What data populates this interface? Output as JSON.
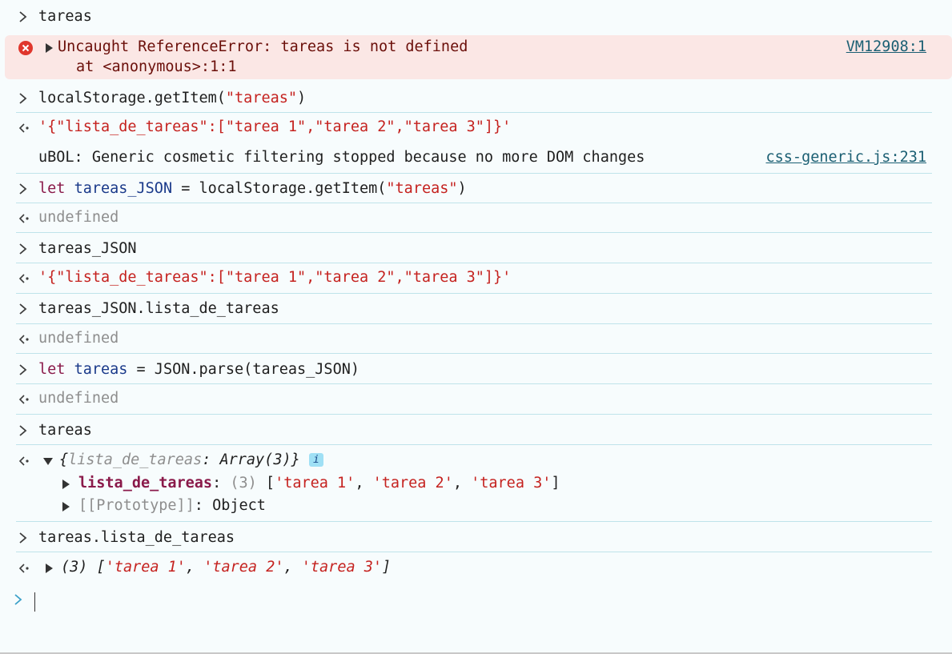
{
  "lines": {
    "l1_cmd": "tareas",
    "err_title": "Uncaught ReferenceError: tareas is not defined",
    "err_at": "at <anonymous>:1:1",
    "err_link": "VM12908:1",
    "l2_cmd": "localStorage.getItem(\"tareas\")",
    "l2_out": "'{\"lista_de_tareas\":[\"tarea 1\",\"tarea 2\",\"tarea 3\"]}'",
    "info_msg": "uBOL: Generic cosmetic filtering stopped because no more DOM changes",
    "info_link": "css-generic.js:231",
    "l3_kw": "let",
    "l3_var": "tareas_JSON",
    "l3_rest": " = localStorage.getItem(",
    "l3_str": "\"tareas\"",
    "l3_close": ")",
    "undefined": "undefined",
    "l4_cmd": "tareas_JSON",
    "l4_out": "'{\"lista_de_tareas\":[\"tarea 1\",\"tarea 2\",\"tarea 3\"]}'",
    "l5_cmd": "tareas_JSON.lista_de_tareas",
    "l6_kw": "let",
    "l6_var": "tareas",
    "l6_rest": " = JSON.parse(tareas_JSON)",
    "l7_cmd": "tareas",
    "obj_summary_open": "{",
    "obj_summary_key": "lista_de_tareas",
    "obj_summary_val": ": Array(3)}",
    "info_badge": "i",
    "prop1_key": "lista_de_tareas",
    "prop1_colon": ": ",
    "prop1_count": "(3) ",
    "prop1_open": "[",
    "prop1_i1": "'tarea 1'",
    "prop1_i2": "'tarea 2'",
    "prop1_i3": "'tarea 3'",
    "prop1_close": "]",
    "comma": ", ",
    "proto_key": "[[Prototype]]",
    "proto_val": ": Object",
    "l8_cmd": "tareas.lista_de_tareas",
    "arr_count": "(3) [",
    "arr_i1": "'tarea 1'",
    "arr_i2": "'tarea 2'",
    "arr_i3": "'tarea 3'",
    "arr_close": "]"
  },
  "colors": {
    "error_bg": "#fbe7e5",
    "string": "#c5221f",
    "keyword": "#8a1a4a",
    "variable": "#1a3a8a",
    "link": "#1b5f73"
  }
}
